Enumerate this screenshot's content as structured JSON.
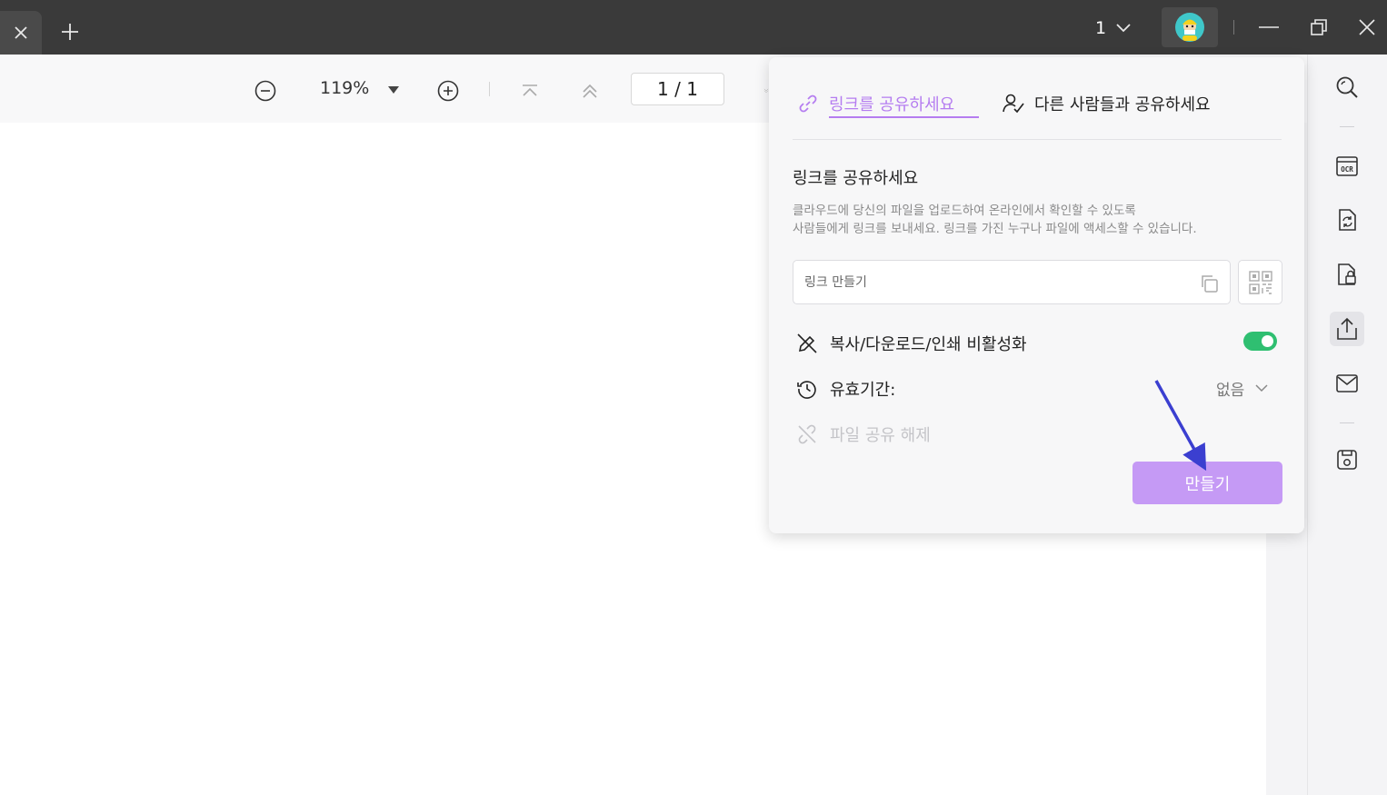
{
  "titlebar": {
    "page_count": "1",
    "window_controls": [
      "minimize-icon",
      "restore-icon",
      "close-icon"
    ]
  },
  "toolbar": {
    "zoom_level": "119%",
    "page_input": "1 / 1",
    "icons": [
      "zoom-out-icon",
      "zoom-dropdown-icon",
      "zoom-in-icon",
      "first-page-icon",
      "previous-page-icon",
      "next-page-icon"
    ]
  },
  "right_rail": {
    "icons": [
      "search-icon",
      "ocr-icon",
      "convert-icon",
      "protect-icon",
      "share-icon",
      "mail-icon",
      "save-icon"
    ],
    "active": "share-icon"
  },
  "share_panel": {
    "tabs": [
      {
        "label": "링크를 공유하세요",
        "icon": "link-icon",
        "active": true
      },
      {
        "label": "다른 사람들과 공유하세요",
        "icon": "people-share-icon",
        "active": false
      }
    ],
    "section_title": "링크를 공유하세요",
    "description_line1": "클라우드에 당신의 파일을 업로드하여 온라인에서 확인할 수 있도록",
    "description_line2": "사람들에게 링크를 보내세요. 링크를 가진 누구나 파일에 액세스할 수 있습니다.",
    "link_placeholder": "링크 만들기",
    "disable_label": "복사/다운로드/인쇄 비활성화",
    "disable_enabled": true,
    "expiry_label": "유효기간:",
    "expiry_value": "없음",
    "unshare_label": "파일 공유 해제",
    "create_label": "만들기"
  },
  "colors": {
    "accent_purple": "#b57df0",
    "create_button": "#c59af5",
    "toggle_green": "#2fbf71",
    "titlebar": "#3a3a3a",
    "annotation_arrow": "#3b3fd0"
  }
}
